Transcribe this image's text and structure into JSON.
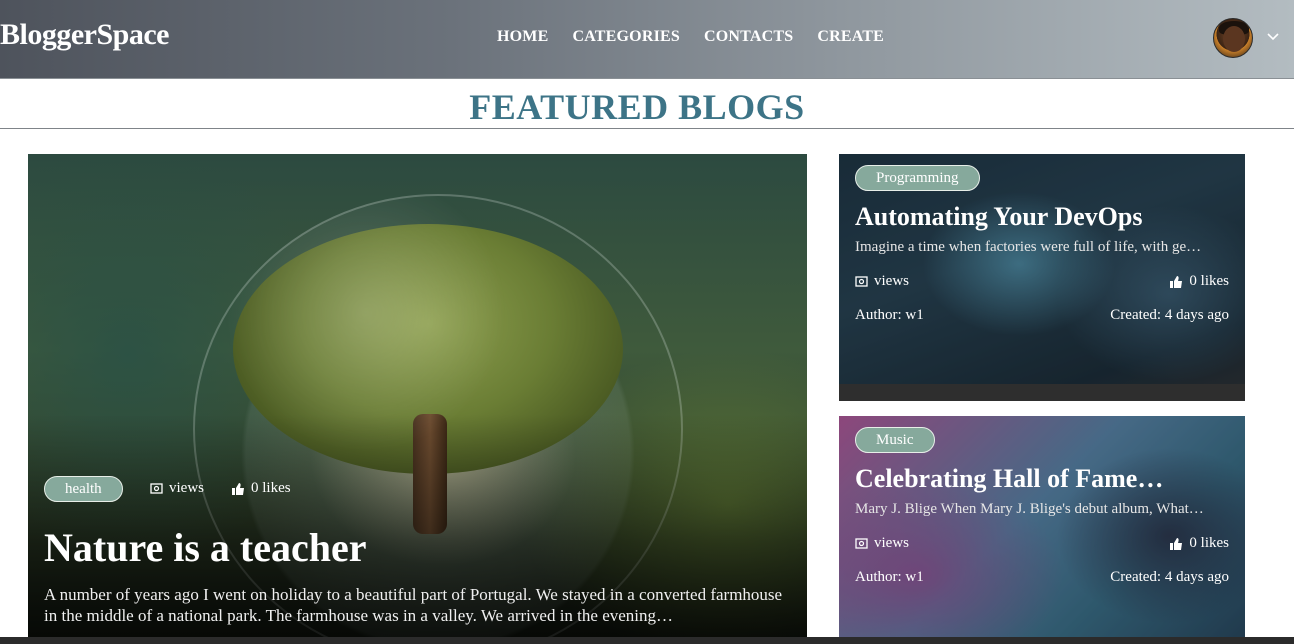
{
  "header": {
    "brand": "BloggerSpace",
    "nav": [
      "HOME",
      "CATEGORIES",
      "CONTACTS",
      "CREATE"
    ]
  },
  "section": {
    "title": "FEATURED BLOGS"
  },
  "featured": {
    "category": "health",
    "views_label": "views",
    "likes_label": "0 likes",
    "title": "Nature is a teacher",
    "excerpt": "A number of years ago I went on holiday to a beautiful part of Portugal. We stayed in a converted farmhouse in the middle of a national park. The farmhouse was in a valley. We arrived in the evening…"
  },
  "side_cards": [
    {
      "category": "Programming",
      "title": "Automating Your DevOps",
      "excerpt": "Imagine a time when factories were full of life, with ge…",
      "views_label": "views",
      "likes_label": "0 likes",
      "author": "Author: w1",
      "created": "Created: 4 days ago"
    },
    {
      "category": "Music",
      "title": "Celebrating Hall of Fame…",
      "excerpt": "Mary J. Blige When Mary J. Blige's debut album, What…",
      "views_label": "views",
      "likes_label": "0 likes",
      "author": "Author: w1",
      "created": "Created: 4 days ago"
    }
  ],
  "colors": {
    "title_accent": "#3d7487",
    "pill_bg": "#86a99c"
  },
  "icons": {
    "views": "eye-icon",
    "likes": "thumbs-up-icon",
    "menu": "chevron-down-icon"
  }
}
